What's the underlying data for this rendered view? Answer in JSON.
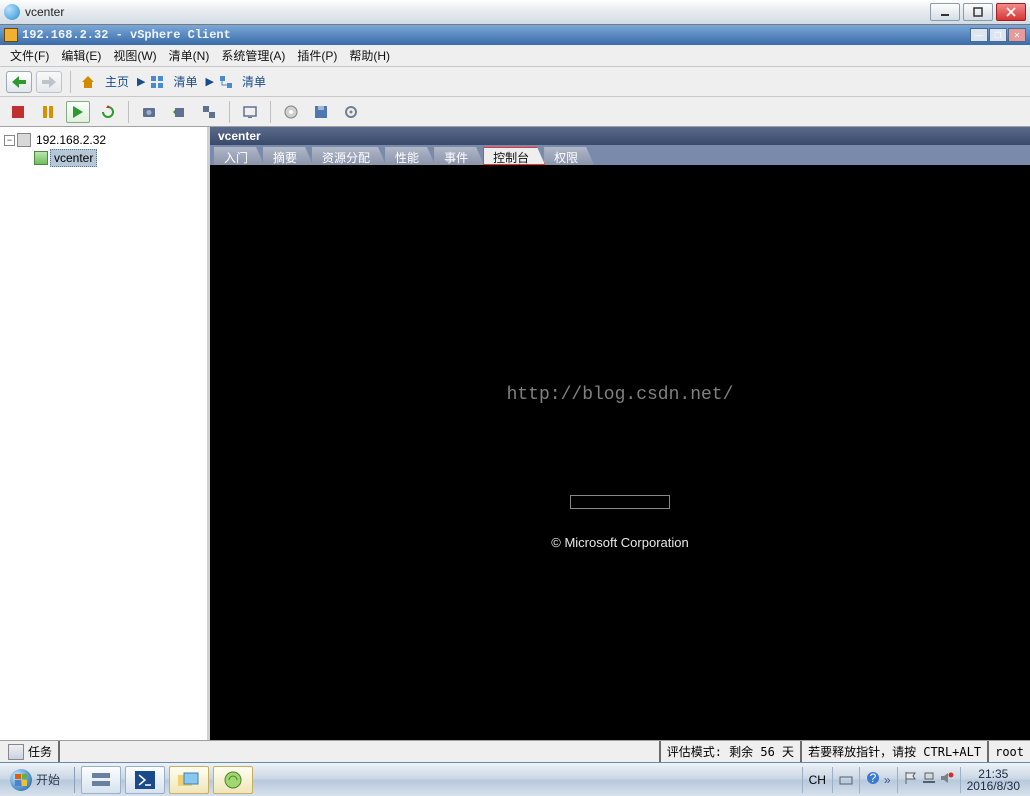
{
  "outer_window": {
    "title": "vcenter"
  },
  "inner_window": {
    "title": "192.168.2.32 - vSphere Client"
  },
  "menu": {
    "file": "文件(F)",
    "edit": "编辑(E)",
    "view": "视图(W)",
    "inventory": "清单(N)",
    "admin": "系统管理(A)",
    "plugins": "插件(P)",
    "help": "帮助(H)"
  },
  "nav": {
    "home": "主页",
    "inv1": "清单",
    "inv2": "清单"
  },
  "tree": {
    "host": "192.168.2.32",
    "vm": "vcenter"
  },
  "content": {
    "header": "vcenter",
    "tabs": {
      "getting_started": "入门",
      "summary": "摘要",
      "resources": "资源分配",
      "performance": "性能",
      "events": "事件",
      "console": "控制台",
      "permissions": "权限"
    },
    "watermark": "http://blog.csdn.net/",
    "copyright": "© Microsoft Corporation"
  },
  "appstatus": {
    "tasks": "任务",
    "eval": "评估模式: 剩余 56 天",
    "release": "若要释放指针，请按 CTRL+ALT",
    "user": "root"
  },
  "taskbar": {
    "start": "开始",
    "lang": "CH",
    "time": "21:35",
    "date": "2016/8/30"
  }
}
